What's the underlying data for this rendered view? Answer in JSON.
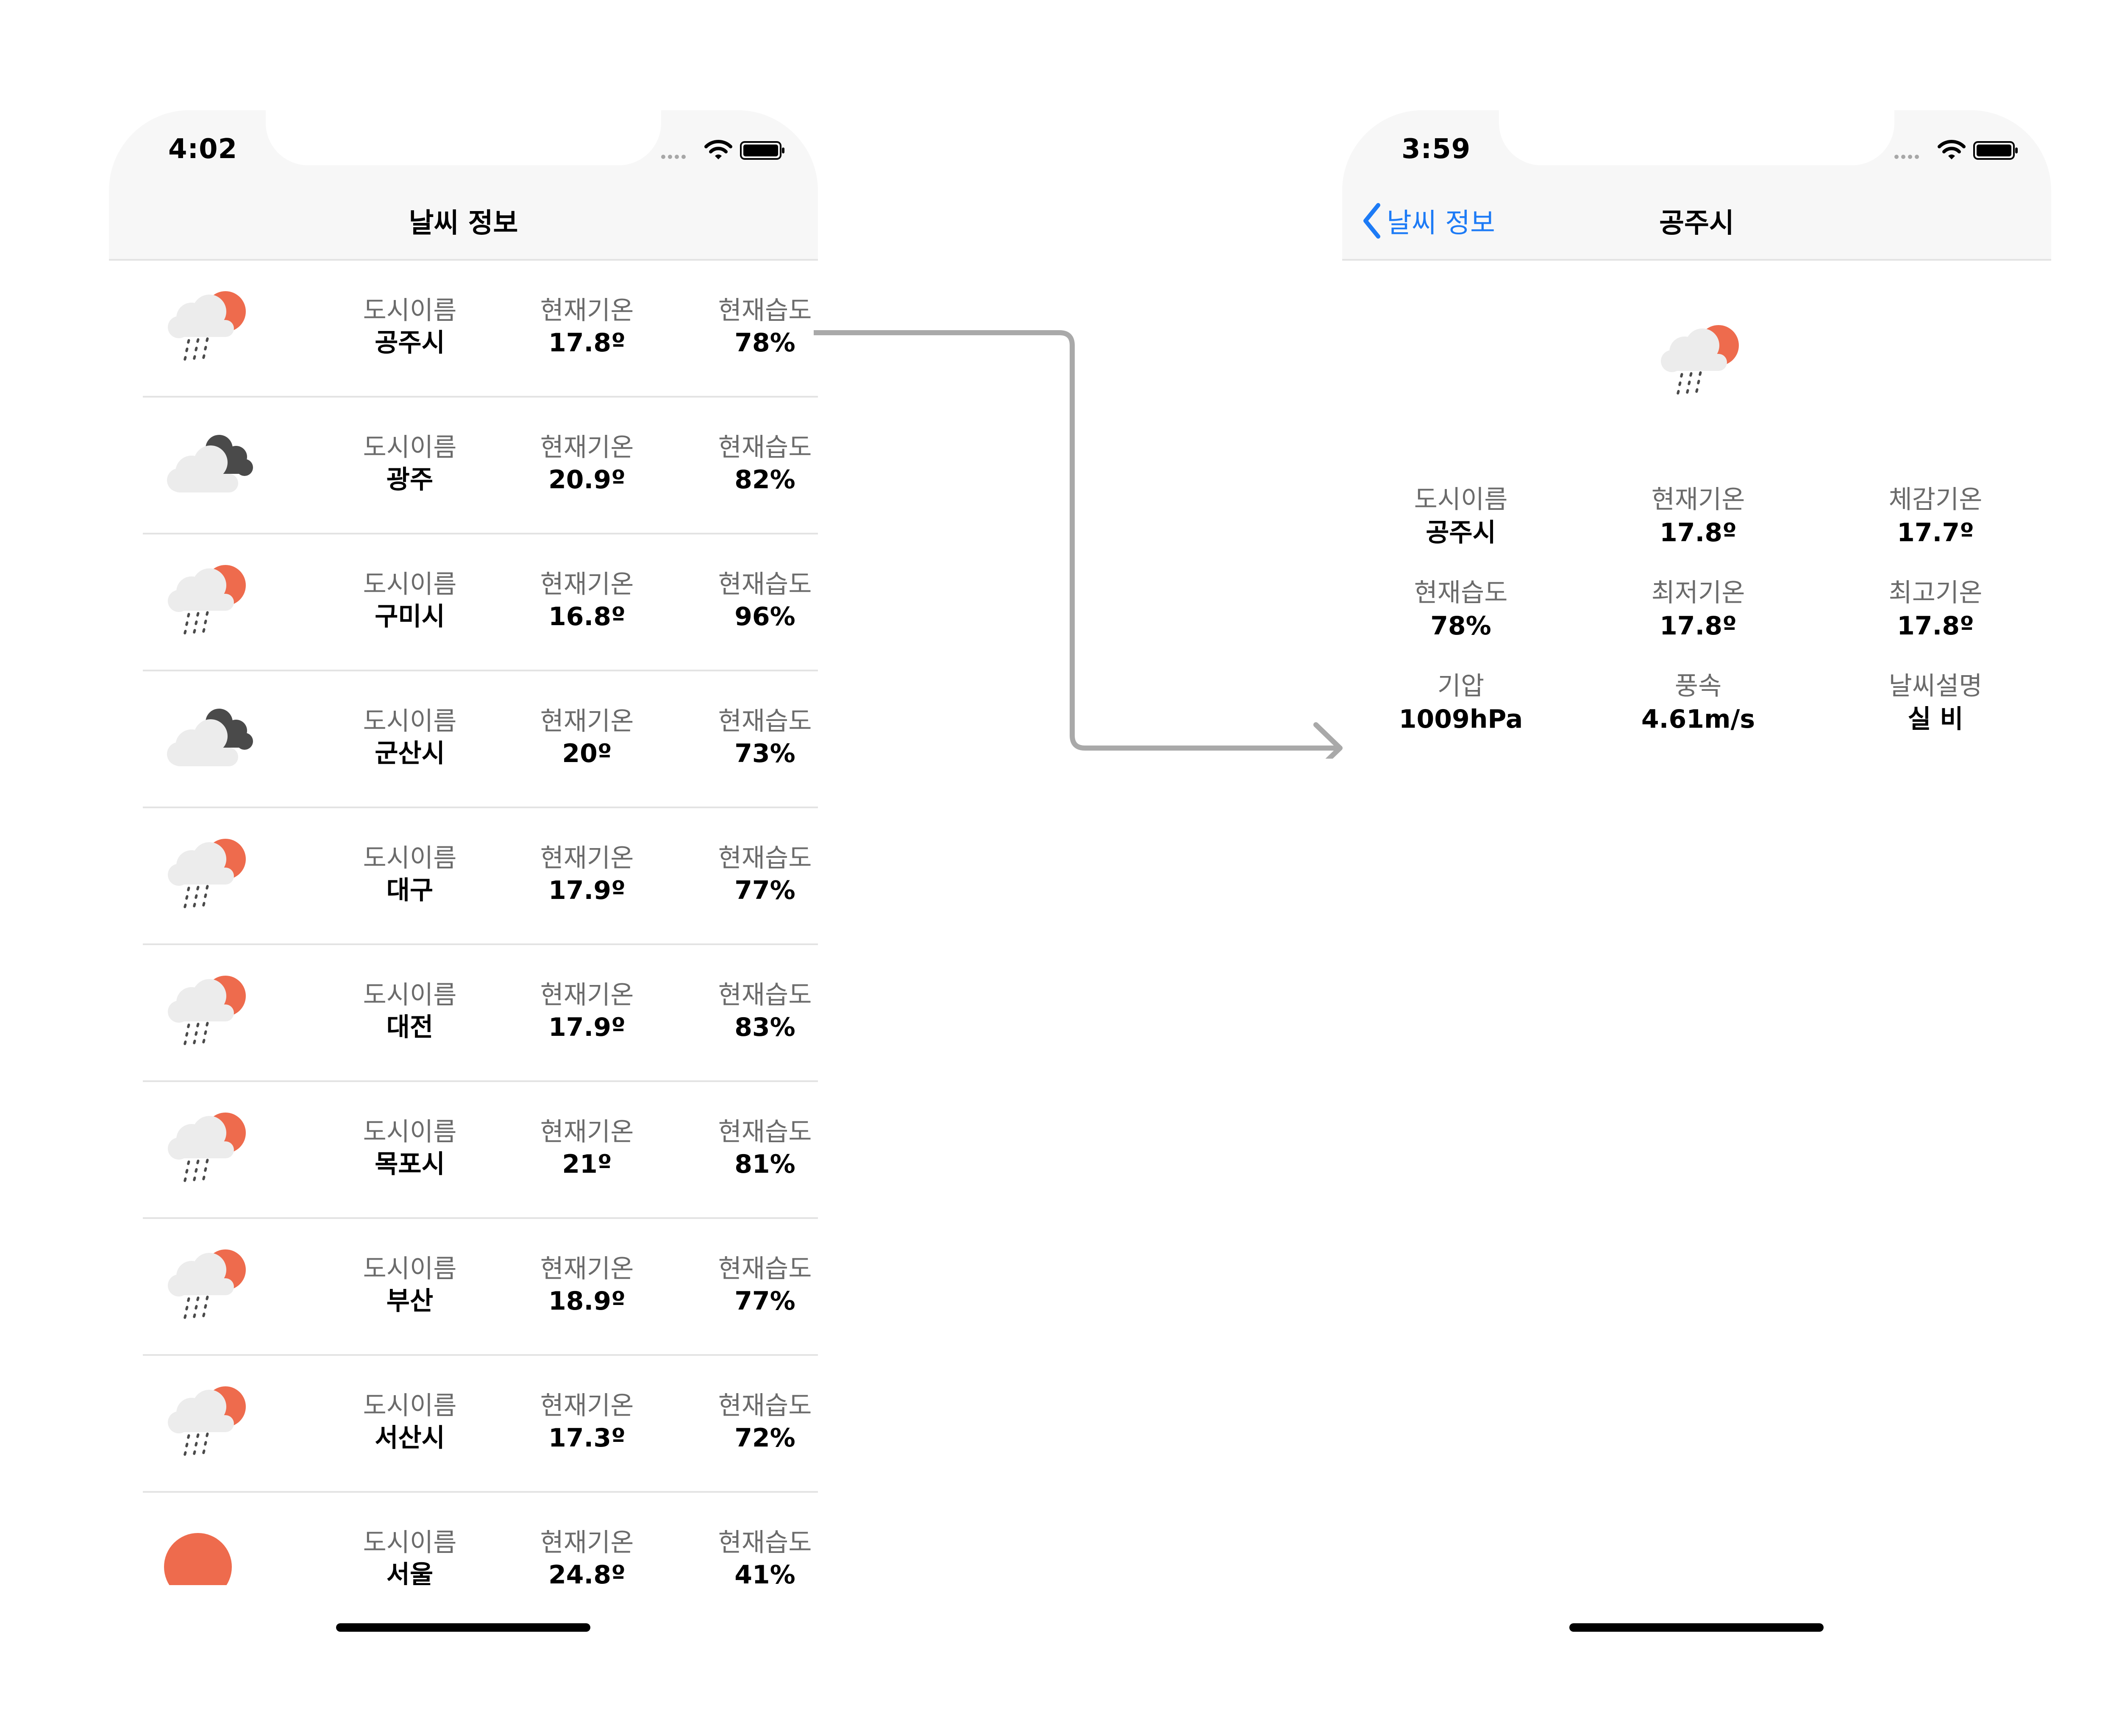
{
  "list_screen": {
    "status_time": "4:02",
    "title": "날씨 정보",
    "rows": [
      {
        "icon": "rain-cloud-sun-icon",
        "city_label": "도시이름",
        "city": "공주시",
        "temp_label": "현재기온",
        "temp": "17.8º",
        "hum_label": "현재습도",
        "hum": "78%"
      },
      {
        "icon": "dark-cloud-icon",
        "city_label": "도시이름",
        "city": "광주",
        "temp_label": "현재기온",
        "temp": "20.9º",
        "hum_label": "현재습도",
        "hum": "82%"
      },
      {
        "icon": "rain-cloud-sun-icon",
        "city_label": "도시이름",
        "city": "구미시",
        "temp_label": "현재기온",
        "temp": "16.8º",
        "hum_label": "현재습도",
        "hum": "96%"
      },
      {
        "icon": "dark-cloud-icon",
        "city_label": "도시이름",
        "city": "군산시",
        "temp_label": "현재기온",
        "temp": "20º",
        "hum_label": "현재습도",
        "hum": "73%"
      },
      {
        "icon": "rain-cloud-sun-icon",
        "city_label": "도시이름",
        "city": "대구",
        "temp_label": "현재기온",
        "temp": "17.9º",
        "hum_label": "현재습도",
        "hum": "77%"
      },
      {
        "icon": "rain-cloud-sun-icon",
        "city_label": "도시이름",
        "city": "대전",
        "temp_label": "현재기온",
        "temp": "17.9º",
        "hum_label": "현재습도",
        "hum": "83%"
      },
      {
        "icon": "rain-cloud-sun-icon",
        "city_label": "도시이름",
        "city": "목포시",
        "temp_label": "현재기온",
        "temp": "21º",
        "hum_label": "현재습도",
        "hum": "81%"
      },
      {
        "icon": "rain-cloud-sun-icon",
        "city_label": "도시이름",
        "city": "부산",
        "temp_label": "현재기온",
        "temp": "18.9º",
        "hum_label": "현재습도",
        "hum": "77%"
      },
      {
        "icon": "rain-cloud-sun-icon",
        "city_label": "도시이름",
        "city": "서산시",
        "temp_label": "현재기온",
        "temp": "17.3º",
        "hum_label": "현재습도",
        "hum": "72%"
      },
      {
        "icon": "sun-icon",
        "city_label": "도시이름",
        "city": "서울",
        "temp_label": "현재기온",
        "temp": "24.8º",
        "hum_label": "현재습도",
        "hum": "41%"
      }
    ]
  },
  "detail_screen": {
    "status_time": "3:59",
    "back_label": "날씨 정보",
    "title": "공주시",
    "icon": "rain-cloud-sun-icon",
    "grid": [
      {
        "label": "도시이름",
        "value": "공주시"
      },
      {
        "label": "현재기온",
        "value": "17.8º"
      },
      {
        "label": "체감기온",
        "value": "17.7º"
      },
      {
        "label": "현재습도",
        "value": "78%"
      },
      {
        "label": "최저기온",
        "value": "17.8º"
      },
      {
        "label": "최고기온",
        "value": "17.8º"
      },
      {
        "label": "기압",
        "value": "1009hPa"
      },
      {
        "label": "풍속",
        "value": "4.61m/s"
      },
      {
        "label": "날씨설명",
        "value": "실 비"
      }
    ]
  },
  "colors": {
    "accent": "#1d7bf6",
    "sun": "#ee6b4d",
    "dark_cloud": "#4a4a4a",
    "cloud": "#ececec",
    "separator": "#e3e3e3",
    "label": "#6b6b6b",
    "arrow": "#a9a9a9"
  }
}
